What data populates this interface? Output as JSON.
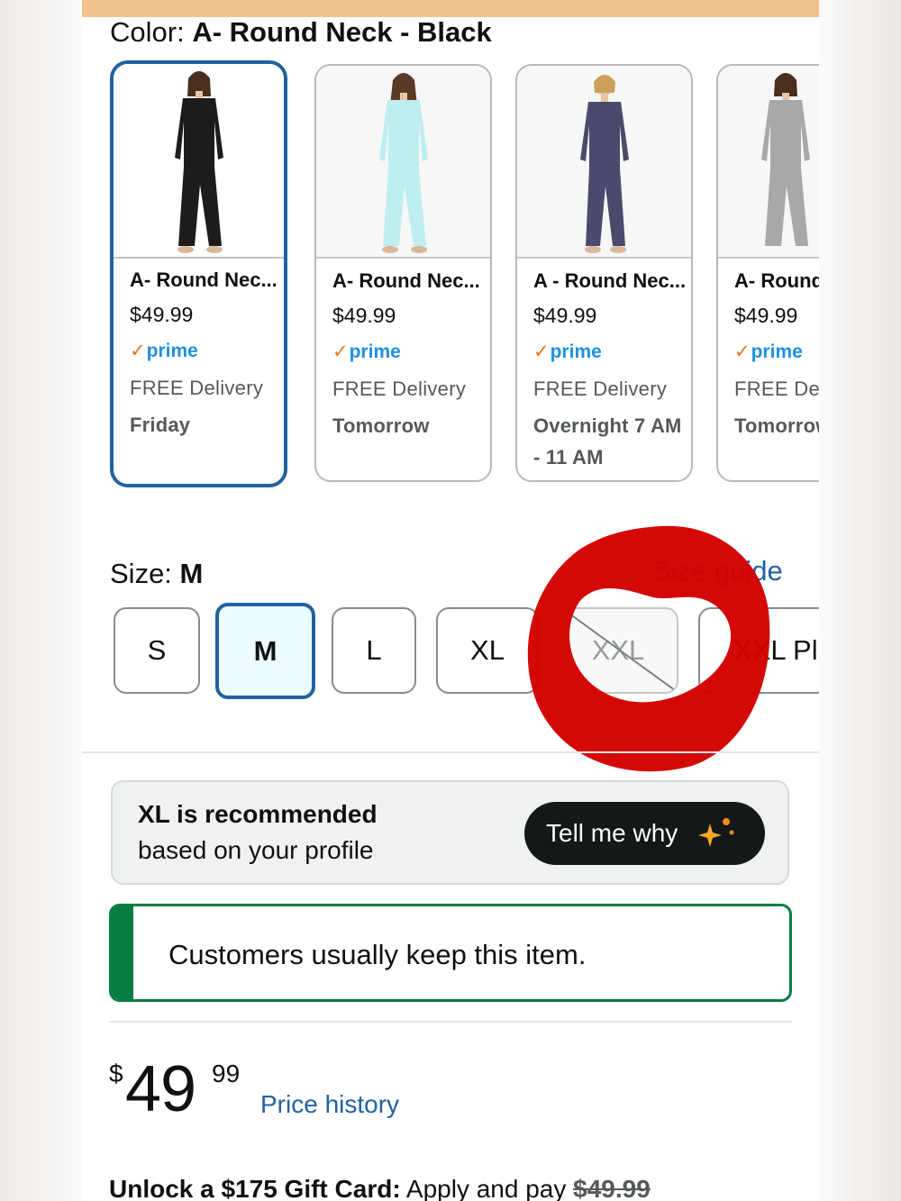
{
  "color": {
    "label": "Color: ",
    "value": "A- Round Neck - Black"
  },
  "swatches": [
    {
      "title": "A- Round Nec...",
      "price": "$49.99",
      "prime": "prime",
      "delivery": "FREE Delivery",
      "day": "Friday",
      "garment": "#1c1c1c",
      "selected": true
    },
    {
      "title": "A- Round Nec...",
      "price": "$49.99",
      "prime": "prime",
      "delivery": "FREE Delivery",
      "day": "Tomorrow",
      "garment": "#bfeef0",
      "selected": false
    },
    {
      "title": "A - Round Nec...",
      "price": "$49.99",
      "prime": "prime",
      "delivery": "FREE Delivery",
      "day": "Overnight 7 AM - 11 AM",
      "garment": "#4b4a6e",
      "selected": false
    },
    {
      "title": "A- Round",
      "price": "$49.99",
      "prime": "prime",
      "delivery": "FREE Deli",
      "day": "Tomorrow",
      "garment": "#a8a8a8",
      "selected": false
    }
  ],
  "size": {
    "label": "Size: ",
    "value": "M",
    "guide": "Size guide",
    "options": [
      "S",
      "M",
      "L",
      "XL",
      "XXL",
      "XXL Pl"
    ]
  },
  "recommendation": {
    "title": "XL is recommended",
    "subtitle": "based on your profile",
    "button": "Tell me why"
  },
  "keep_notice": "Customers usually keep this item.",
  "price": {
    "currency": "$",
    "whole": "49",
    "fraction": "99",
    "history_link": "Price history"
  },
  "gift": {
    "bold": "Unlock a $175 Gift Card:",
    "text": " Apply and pay ",
    "old_price": "$49.99"
  },
  "colors": {
    "selected_border": "#22629e",
    "link": "#2162a1",
    "green": "#067d41",
    "prime_blue": "#1d90e0",
    "prime_check": "#e8761e",
    "annotation_red": "#d40000",
    "top_bar": "#f1c28f"
  },
  "icons": [
    "prime-check-icon",
    "sparkle-icon",
    "unavailable-slash"
  ]
}
